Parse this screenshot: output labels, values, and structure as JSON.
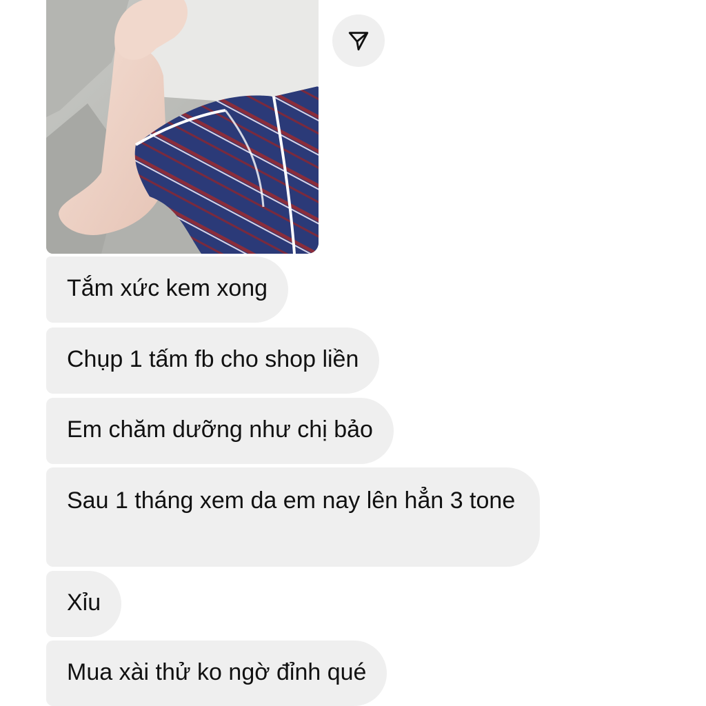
{
  "conversation": {
    "photo": {
      "alt_subject": "arm-in-striped-pajamas-photo"
    },
    "share_icon": "send-paper-plane-icon",
    "messages": [
      {
        "text": "Tắm xức kem xong"
      },
      {
        "text": "Chụp 1 tấm fb cho shop liền"
      },
      {
        "text": "Em chăm dưỡng như chị bảo"
      },
      {
        "text": "Sau 1 tháng xem da em nay lên hẳn 3 tone"
      },
      {
        "text": "Xỉu"
      },
      {
        "text": "Mua xài thử ko ngờ đỉnh qué"
      }
    ]
  },
  "colors": {
    "bubble_bg": "#efefef",
    "text": "#111111",
    "share_bg": "#efefef",
    "pajama_blue": "#2b3a78",
    "pajama_red": "#8a2d3b"
  }
}
